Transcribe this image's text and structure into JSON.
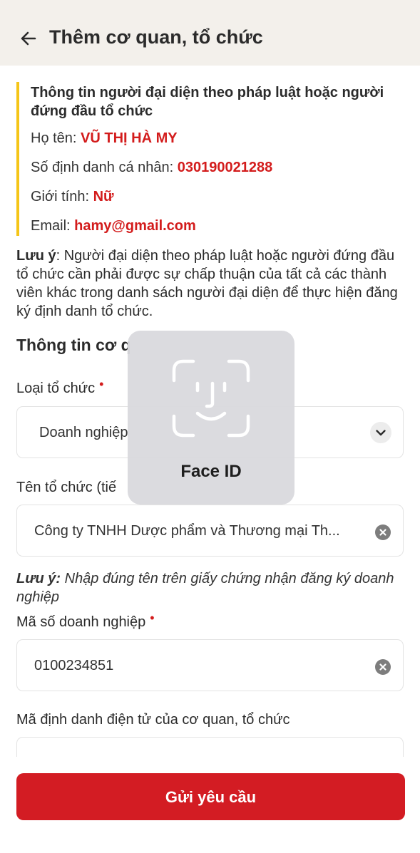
{
  "header": {
    "title": "Thêm cơ quan, tổ chức"
  },
  "representative": {
    "heading": "Thông tin người đại diện theo pháp luật hoặc người đứng đầu tổ chức",
    "name_label": "Họ tên:",
    "name_value": "VŨ THỊ HÀ MY",
    "id_label": "Số định danh cá nhân:",
    "id_value": "030190021288",
    "gender_label": "Giới tính:",
    "gender_value": "Nữ",
    "email_label": "Email:",
    "email_value": "hamy@gmail.com"
  },
  "note1": {
    "label": "Lưu ý",
    "text": ": Người đại diện theo pháp luật hoặc người đứng đầu tổ chức cần phải được sự chấp thuận của tất cả các thành viên khác trong danh sách người đại diện để thực hiện đăng ký định danh tổ chức."
  },
  "section": {
    "title": "Thông tin cơ q"
  },
  "fields": {
    "org_type_label": "Loại tổ chức",
    "org_type_value": "Doanh nghiệp",
    "org_name_label": "Tên tổ chức (tiế",
    "org_name_value": "Công ty TNHH Dược phẩm và Thương mại Th...",
    "business_code_label": "Mã số doanh nghiệp",
    "business_code_value": "0100234851",
    "electronic_id_label": "Mã định danh điện tử của cơ quan, tổ chức",
    "required_mark": "•"
  },
  "note2": {
    "label": "Lưu ý:",
    "text": " Nhập đúng tên trên giấy chứng nhận đăng ký doanh nghiệp"
  },
  "submit": {
    "label": "Gửi yêu cầu"
  },
  "face_id": {
    "label": "Face ID"
  },
  "colors": {
    "accent_red": "#d31c23",
    "highlight_red": "#d31c1c",
    "yellow_bar": "#f5c518",
    "header_bg": "#f3f0eb"
  },
  "icons": {
    "back": "arrow-left-icon",
    "chevron": "chevron-down-icon",
    "clear": "clear-circle-icon",
    "face_id": "face-id-icon"
  }
}
